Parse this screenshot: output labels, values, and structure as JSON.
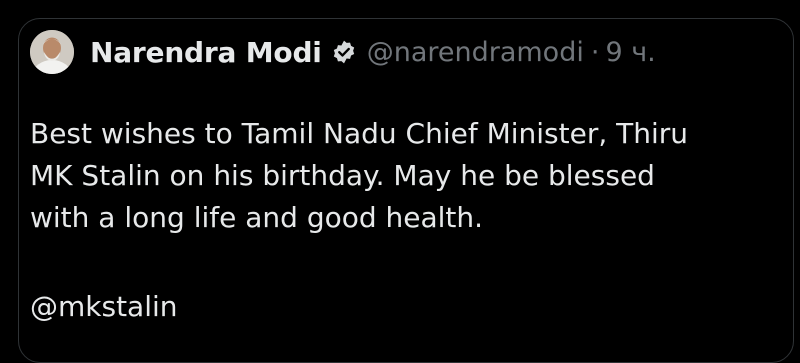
{
  "post": {
    "author_name": "Narendra Modi",
    "author_handle": "@narendramodi",
    "separator": "·",
    "time": "9 ч.",
    "verified_badge_icon": "verified-check-icon",
    "text_lines": "Best wishes to Tamil Nadu Chief Minister, Thiru\nMK Stalin on his birthday. May he be blessed\nwith a long life and good health.",
    "mention": "@mkstalin"
  },
  "colors": {
    "background": "#000000",
    "border": "#2f3336",
    "primary_text": "#e7e9ea",
    "secondary_text": "#71767b",
    "badge": "#1d9bf0"
  }
}
